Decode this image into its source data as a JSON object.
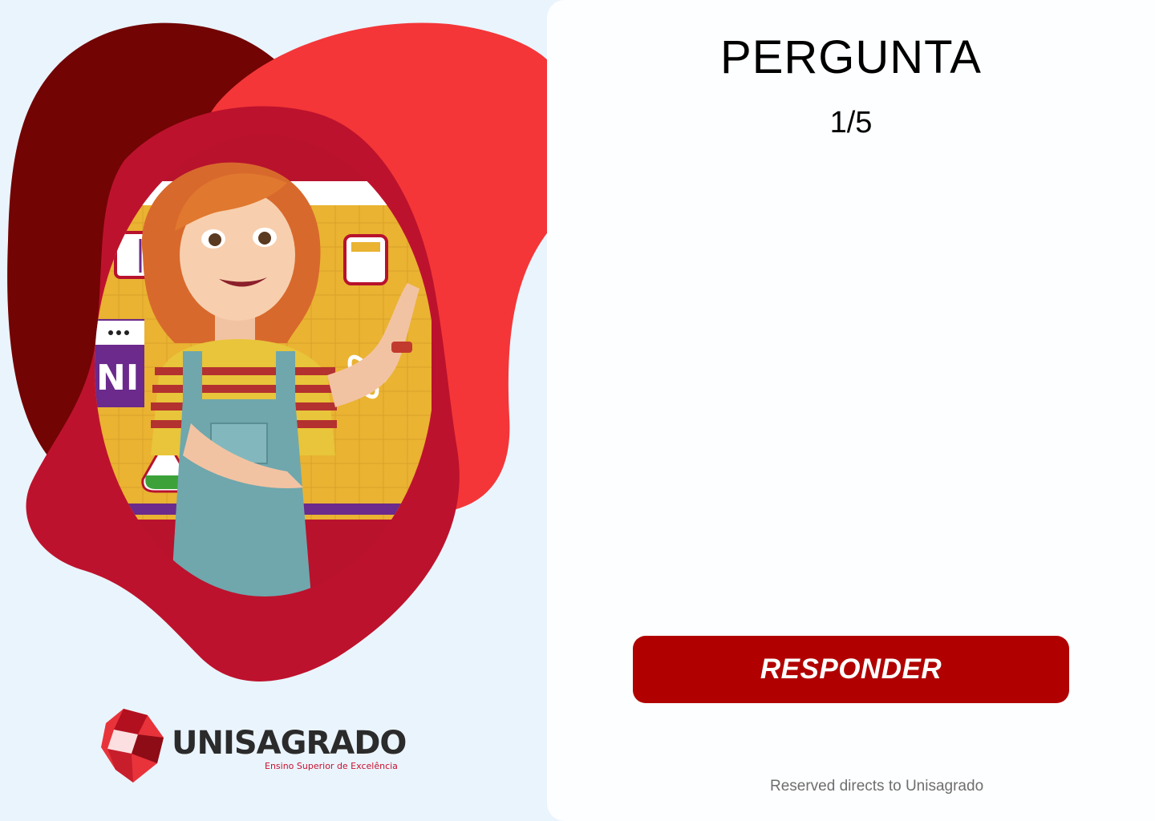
{
  "quiz": {
    "title": "PERGUNTA",
    "counter": "1/5",
    "answer_button_label": "RESPONDER",
    "footer_text": "Reserved directs to Unisagrado"
  },
  "brand": {
    "name": "UNISAGRADO",
    "tagline": "Ensino Superior de Excelência",
    "colors": {
      "primary_red": "#b10000",
      "blob_dark_red": "#720404",
      "blob_bright_red": "#f43638",
      "blob_crimson": "#bd122d",
      "background": "#eaf4fd"
    }
  },
  "illustration": {
    "screen_badge_text": "NI"
  }
}
